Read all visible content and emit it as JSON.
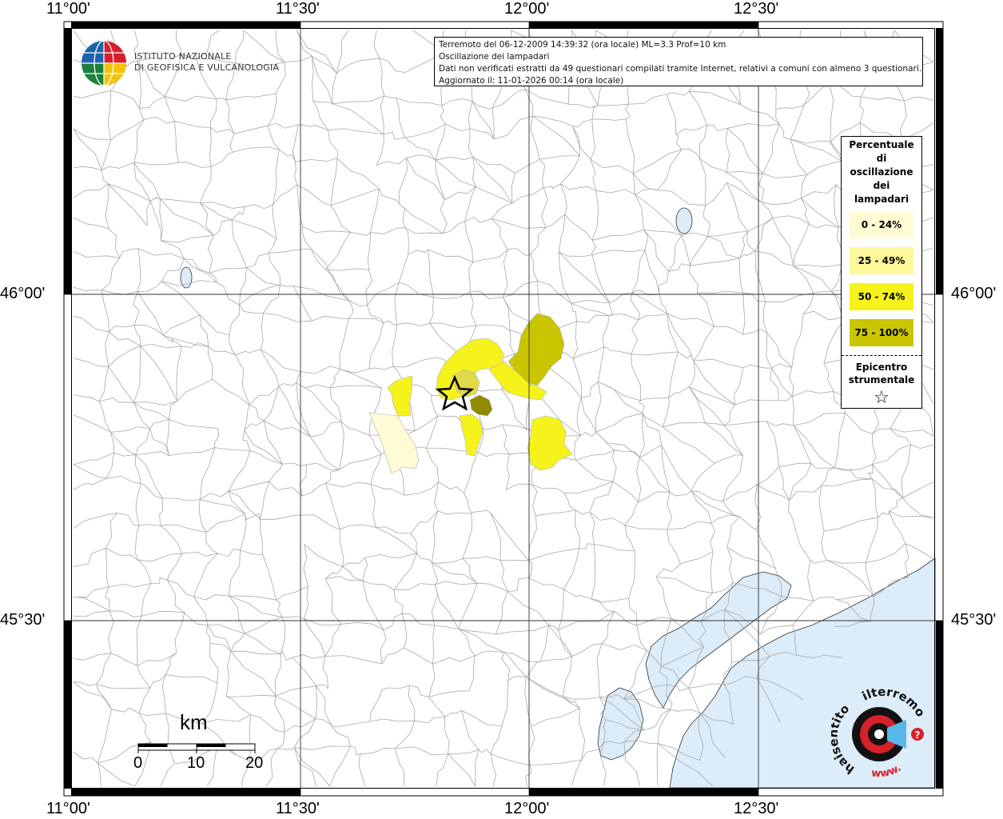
{
  "info": {
    "line1": "Terremoto del 06-12-2009 14:39:32 (ora locale) ML=3.3 Prof=10 km",
    "line2": "Oscillazione dei lampadari",
    "line3": "Dati non verificati estratti da 49 questionari compilati tramite Internet, relativi a comuni con almeno 3 questionari.",
    "line4": "Aggiornato il: 11-01-2026 00:14 (ora locale)"
  },
  "axes": {
    "top": [
      "11°00'",
      "11°30'",
      "12°00'",
      "12°30'"
    ],
    "bottom": [
      "11°00'",
      "11°30'",
      "12°00'",
      "12°30'"
    ],
    "left": [
      "46°00'",
      "45°30'"
    ],
    "right": [
      "46°00'",
      "45°30'"
    ]
  },
  "legend": {
    "title_lines": [
      "Percentuale",
      "di",
      "oscillazione",
      "dei",
      "lampadari"
    ],
    "items": [
      {
        "label": "0 - 24%",
        "color": "#fffbd4"
      },
      {
        "label": "25 - 49%",
        "color": "#fdf99a"
      },
      {
        "label": "50 - 74%",
        "color": "#f6f31c"
      },
      {
        "label": "75 - 100%",
        "color": "#c9c501"
      }
    ],
    "epicenter_lines": [
      "Epicentro",
      "strumentale"
    ],
    "epicenter_symbol": "☆"
  },
  "logo": {
    "line1": "ISTITUTO NAZIONALE",
    "line2": "DI GEOFISICA E VULCANOLOGIA"
  },
  "scale": {
    "unit": "km",
    "ticks": [
      "0",
      "10",
      "20"
    ]
  },
  "badge": {
    "text_left": "haisentito",
    "text_top": "ilterremoto.it",
    "text_bottom": "www.",
    "question": "?"
  },
  "colors": {
    "water": "#dcecf8",
    "boundary": "#a8a8a8",
    "frame": "#000000",
    "epicenter_dark": "#8f8b02"
  }
}
